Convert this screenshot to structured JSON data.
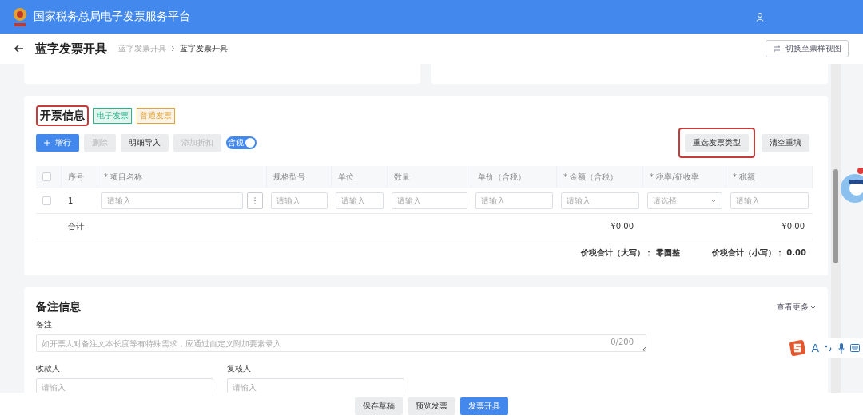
{
  "header": {
    "title": "国家税务总局电子发票服务平台"
  },
  "subheader": {
    "title": "蓝字发票开具",
    "breadcrumb": [
      {
        "label": "蓝字发票开具",
        "selected": false
      },
      {
        "label": "蓝字发票开具",
        "selected": true
      }
    ],
    "switch_button": "切换至票样视图"
  },
  "invoice_info": {
    "title": "开票信息",
    "highlighted": true,
    "tags": [
      {
        "label": "电子发票",
        "color": "#27b58a"
      },
      {
        "label": "普通发票",
        "color": "#e3a33b"
      }
    ],
    "toolbar": [
      {
        "label": "增行",
        "kind": "primary",
        "disabled": false
      },
      {
        "label": "删除",
        "kind": "plain",
        "disabled": true
      },
      {
        "label": "明细导入",
        "kind": "plain",
        "disabled": false
      },
      {
        "label": "添加折扣",
        "kind": "plain",
        "disabled": true
      }
    ],
    "tax_toggle": {
      "label": "含税",
      "on": true
    },
    "right_buttons": [
      {
        "label": "重选发票类型",
        "highlighted": true
      },
      {
        "label": "清空重填",
        "highlighted": false
      }
    ],
    "table": {
      "header_checked": false,
      "columns": [
        {
          "label": "序号"
        },
        {
          "label": "* 项目名称"
        },
        {
          "label": "规格型号"
        },
        {
          "label": "单位"
        },
        {
          "label": "数量"
        },
        {
          "label": "单价（含税）"
        },
        {
          "label": "* 金额（含税）"
        },
        {
          "label": "* 税率/征收率"
        },
        {
          "label": "* 税额"
        }
      ],
      "rows": [
        {
          "checked": false,
          "cells": [
            {
              "kind": "text",
              "text": "1"
            },
            {
              "kind": "input_more",
              "placeholder": "请输入"
            },
            {
              "kind": "input",
              "placeholder": "请输入"
            },
            {
              "kind": "input",
              "placeholder": "请输入"
            },
            {
              "kind": "input",
              "placeholder": "请输入"
            },
            {
              "kind": "input",
              "placeholder": "请输入"
            },
            {
              "kind": "input",
              "placeholder": "请输入"
            },
            {
              "kind": "select",
              "placeholder": "请选择"
            },
            {
              "kind": "input",
              "placeholder": "请输入"
            }
          ]
        }
      ],
      "total": {
        "label": "合计",
        "amount": "¥0.00",
        "tax": "¥0.00"
      }
    },
    "summary": [
      {
        "label": "价税合计（大写）：",
        "value": "零圆整"
      },
      {
        "label": "价税合计（小写）：",
        "value": "0.00"
      }
    ]
  },
  "remarks": {
    "title": "备注信息",
    "more": "查看更多",
    "note_label": "备注",
    "note_placeholder": "如开票人对备注文本长度等有特殊需求，应通过自定义附加要素录入",
    "note_counter": "0/200",
    "people": [
      {
        "label": "收款人",
        "placeholder": "请输入"
      },
      {
        "label": "复核人",
        "placeholder": "请输入"
      }
    ]
  },
  "ime": {
    "letter": "A"
  },
  "footer": [
    {
      "label": "保存草稿",
      "kind": "plain"
    },
    {
      "label": "预览发票",
      "kind": "plain"
    },
    {
      "label": "发票开具",
      "kind": "primary"
    }
  ]
}
